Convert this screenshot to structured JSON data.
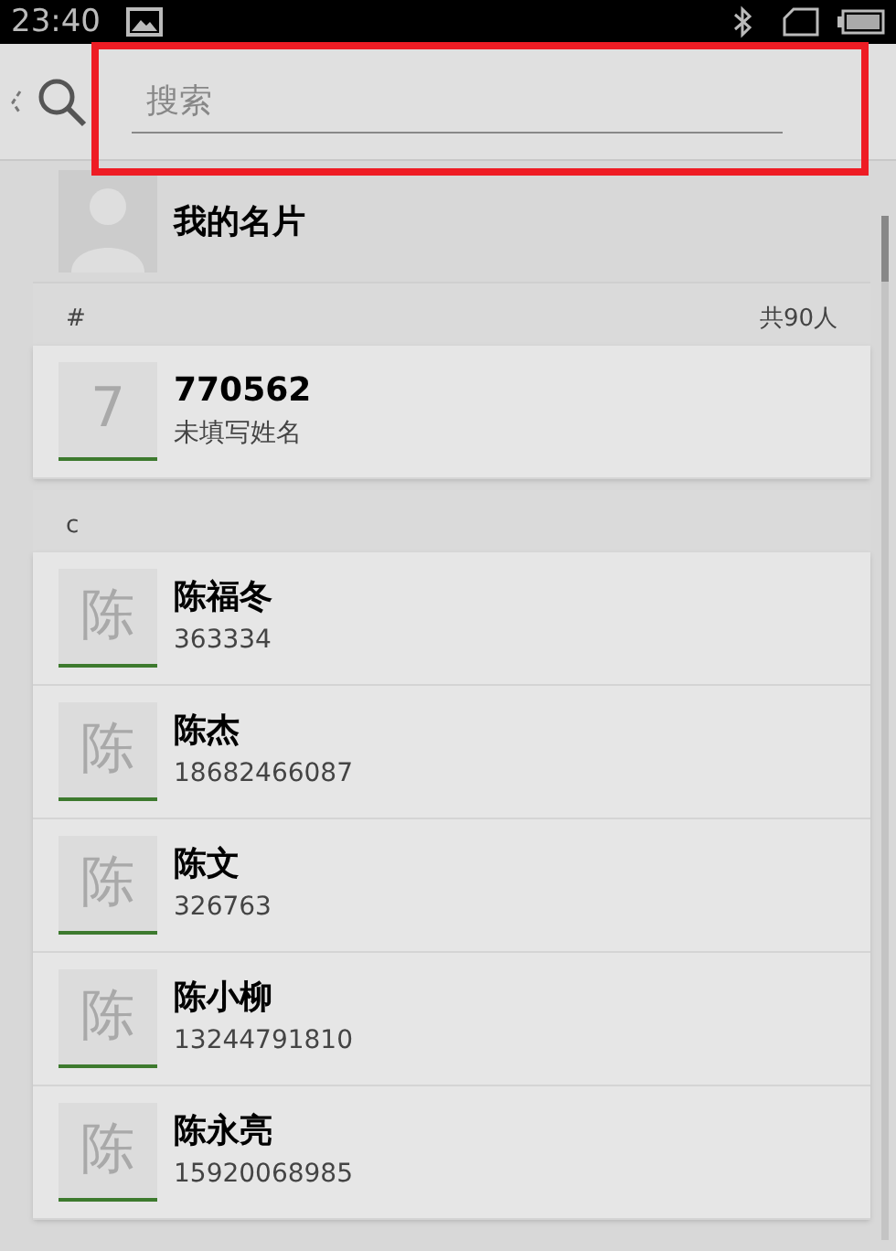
{
  "status_bar": {
    "time": "23:40"
  },
  "search": {
    "placeholder": "搜索"
  },
  "my_card": {
    "label": "我的名片"
  },
  "sections": [
    {
      "letter": "#",
      "count": "共90人",
      "contacts": [
        {
          "initial": "7",
          "name": "770562",
          "detail": "未填写姓名"
        }
      ]
    },
    {
      "letter": "c",
      "contacts": [
        {
          "initial": "陈",
          "name": "陈福冬",
          "detail": "363334"
        },
        {
          "initial": "陈",
          "name": "陈杰",
          "detail": "18682466087"
        },
        {
          "initial": "陈",
          "name": "陈文",
          "detail": "326763"
        },
        {
          "initial": "陈",
          "name": "陈小柳",
          "detail": "13244791810"
        },
        {
          "initial": "陈",
          "name": "陈永亮",
          "detail": "15920068985"
        }
      ]
    }
  ]
}
